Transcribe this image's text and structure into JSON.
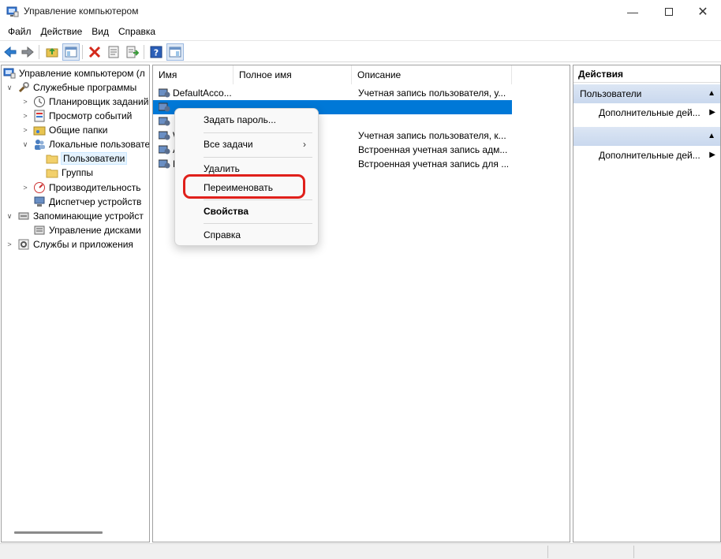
{
  "window": {
    "title": "Управление компьютером",
    "controls": [
      "minimize-icon",
      "maximize-icon",
      "close-icon"
    ]
  },
  "menubar": {
    "items": [
      "Файл",
      "Действие",
      "Вид",
      "Справка"
    ]
  },
  "toolbar": {
    "buttons": [
      "back-icon",
      "forward-icon",
      "up-folder-icon",
      "show-hide-tree-icon",
      "delete-icon",
      "properties-icon",
      "export-list-icon",
      "help-icon",
      "show-hide-action-pane-icon"
    ]
  },
  "tree": {
    "root": "Управление компьютером (л",
    "items": [
      {
        "label": "Служебные программы",
        "icon": "tools-icon"
      },
      {
        "label": "Планировщик заданий",
        "icon": "clock-icon"
      },
      {
        "label": "Просмотр событий",
        "icon": "event-viewer-icon"
      },
      {
        "label": "Общие папки",
        "icon": "shared-folder-icon"
      },
      {
        "label": "Локальные пользовате",
        "icon": "users-icon"
      },
      {
        "label": "Пользователи",
        "icon": "folder-icon"
      },
      {
        "label": "Группы",
        "icon": "folder-icon"
      },
      {
        "label": "Производительность",
        "icon": "performance-icon"
      },
      {
        "label": "Диспетчер устройств",
        "icon": "device-manager-icon"
      },
      {
        "label": "Запоминающие устройст",
        "icon": "storage-icon"
      },
      {
        "label": "Управление дисками",
        "icon": "disk-icon"
      },
      {
        "label": "Службы и приложения",
        "icon": "services-icon"
      }
    ]
  },
  "list": {
    "columns": [
      "Имя",
      "Полное имя",
      "Описание"
    ],
    "rows": [
      {
        "name": "DefaultAcco...",
        "full_name": "",
        "description": "Учетная запись пользователя, у..."
      },
      {
        "name": "",
        "full_name": "",
        "description": ""
      },
      {
        "name": "",
        "full_name": "",
        "description": ""
      },
      {
        "name": "W",
        "full_name": "",
        "description": "Учетная запись пользователя, к..."
      },
      {
        "name": "А",
        "full_name": "",
        "description": "Встроенная учетная запись адм..."
      },
      {
        "name": "Г",
        "full_name": "",
        "description": "Встроенная учетная запись для ..."
      }
    ]
  },
  "actions": {
    "header": "Действия",
    "section1": "Пользователи",
    "more1": "Дополнительные дей...",
    "section2": "",
    "more2": "Дополнительные дей..."
  },
  "context_menu": {
    "items": {
      "set_password": "Задать пароль...",
      "all_tasks": "Все задачи",
      "delete": "Удалить",
      "rename": "Переименовать",
      "properties": "Свойства",
      "help": "Справка"
    },
    "highlighted": "rename",
    "highlight_color": "#e0201b"
  },
  "colors": {
    "selection": "#0078d7",
    "actions_section": "#c9d8ee"
  }
}
